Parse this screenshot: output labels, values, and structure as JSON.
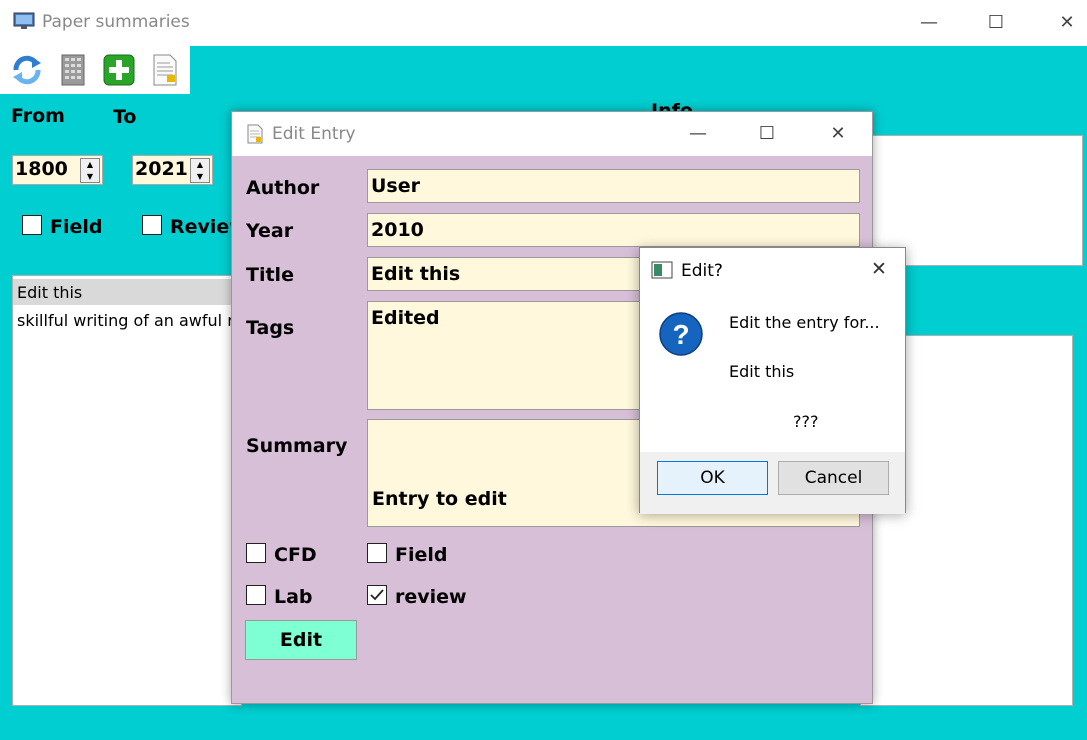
{
  "main_window": {
    "title": "Paper summaries",
    "controls": {
      "minimize": "—",
      "maximize": "☐",
      "close": "✕"
    },
    "toolbar_icons": [
      "refresh-icon",
      "database-icon",
      "add-icon",
      "document-icon"
    ],
    "from_label": "From",
    "to_label": "To",
    "from_value": "1800",
    "to_value": "2021",
    "filter_field_label": "Field",
    "filter_review_label": "Review",
    "info_label": "Info",
    "list_selected": "Edit this",
    "list_text": "skillful writing of an awful re"
  },
  "edit_dialog": {
    "title": "Edit Entry",
    "author_label": "Author",
    "author_value": "User",
    "year_label": "Year",
    "year_value": "2010",
    "title_label": "Title",
    "title_value": "Edit this",
    "tags_label": "Tags",
    "tags_value": "Edited",
    "summary_label": "Summary",
    "summary_value": "Entry to edit",
    "cfd_label": "CFD",
    "field_label": "Field",
    "lab_label": "Lab",
    "review_label": "review",
    "review_checked": true,
    "edit_button": "Edit"
  },
  "message_box": {
    "title": "Edit?",
    "line1": "Edit the entry for...",
    "line2": "Edit this",
    "line3": "???",
    "ok_label": "OK",
    "cancel_label": "Cancel"
  },
  "colors": {
    "background": "#00ced1",
    "dialog": "#d8bfd8",
    "field": "#fff8dc",
    "edit_button": "#7fffd4"
  }
}
